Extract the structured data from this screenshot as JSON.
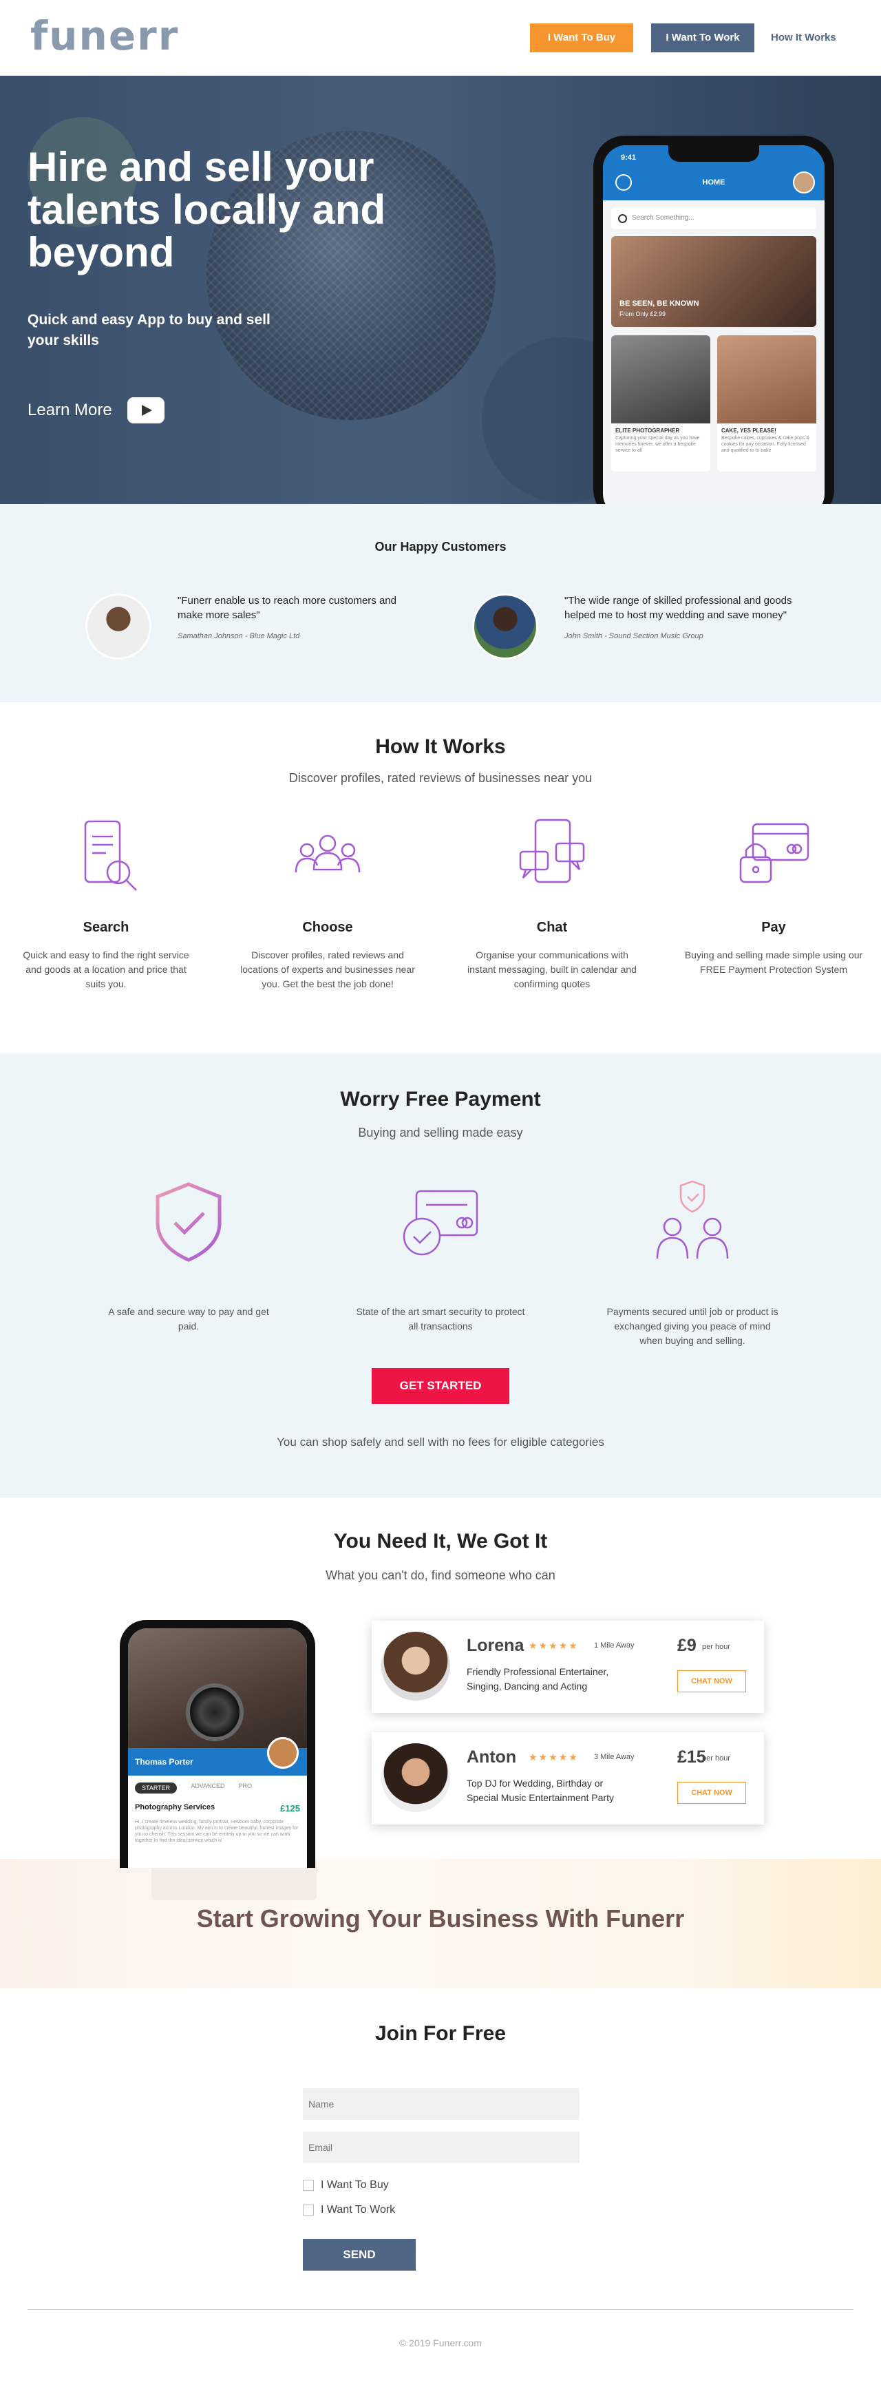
{
  "header": {
    "logo": "funerr",
    "buy_label": "I Want To Buy",
    "work_label": "I Want To Work",
    "how_label": "How It Works"
  },
  "hero": {
    "title": "Hire and sell your talents locally and beyond",
    "subtitle": "Quick and easy App to buy and sell your skills",
    "learn_more": "Learn More"
  },
  "phone": {
    "time": "9:41",
    "screen_title": "HOME",
    "search_placeholder": "Search Something...",
    "featured_title": "BE SEEN, BE KNOWN",
    "featured_sub": "From Only £2.99",
    "card1_title": "ELITE PHOTOGRAPHER",
    "card1_desc": "Capturing your special day as you have memories forever, we offer a bespoke service to all",
    "card2_title": "CAKE, YES PLEASE!",
    "card2_desc": "Bespoke cakes, cupcakes & cake pops & cookies for any occasion. Fully licensed and qualified to to bake"
  },
  "customers": {
    "heading": "Our Happy Customers",
    "items": [
      {
        "quote": "\"Funerr enable us to reach more customers and make more sales\"",
        "who": "Samathan Johnson - Blue Magic Ltd"
      },
      {
        "quote": "\"The wide range of skilled professional and goods helped me to host my wedding and save money\"",
        "who": "John Smith - Sound Section Music Group"
      }
    ]
  },
  "how": {
    "title": "How It Works",
    "subtitle": "Discover profiles, rated reviews of businesses near you",
    "items": [
      {
        "title": "Search",
        "text": "Quick and easy to find the right service and goods at a location and price that suits you.",
        "icon": "search-phone-icon"
      },
      {
        "title": "Choose",
        "text": "Discover profiles, rated reviews and locations of experts and businesses near you. Get the best the job done!",
        "icon": "people-group-icon"
      },
      {
        "title": "Chat",
        "text": "Organise your communications with instant messaging, built in calendar and confirming quotes",
        "icon": "chat-phone-icon"
      },
      {
        "title": "Pay",
        "text": "Buying and selling made simple using our FREE Payment Protection System",
        "icon": "card-lock-icon"
      }
    ]
  },
  "payment": {
    "title": "Worry Free Payment",
    "subtitle": "Buying and selling made easy",
    "items": [
      {
        "text": "A safe and secure way to pay and get paid.",
        "icon": "shield-check-icon"
      },
      {
        "text": "State of the art smart security to protect all transactions",
        "icon": "card-check-icon"
      },
      {
        "text": "Payments secured until job or product is exchanged giving you peace of mind when buying and selling.",
        "icon": "people-shield-icon"
      }
    ],
    "cta": "GET STARTED",
    "note": "You can shop safely and sell with no fees for eligible categories"
  },
  "need": {
    "title": "You Need It, We Got It",
    "subtitle": "What you can't do, find someone who can",
    "phone": {
      "name": "Thomas Porter",
      "tabs": [
        "STARTER",
        "ADVANCED",
        "PRO"
      ],
      "service": "Photography Services",
      "price": "£125",
      "desc": "Hi, I create timeless wedding, family portrait, newborn baby, corporate photography across London. My aim is to create beautiful, honest images for you to cherish. This session we can be entirely up to you so we can work together to find the ideal service which is"
    },
    "profiles": [
      {
        "name": "Lorena",
        "stars": "★★★★★",
        "distance": "1 Mile Away",
        "desc": "Friendly Professional Entertainer, Singing, Dancing and Acting",
        "price": "£9",
        "per": "per hour",
        "chat": "CHAT NOW"
      },
      {
        "name": "Anton",
        "stars": "★★★★★",
        "distance": "3 Mile Away",
        "desc": "Top DJ for Wedding, Birthday or Special Music Entertainment Party",
        "price": "£15",
        "per": "per hour",
        "chat": "CHAT NOW"
      }
    ]
  },
  "grow": {
    "title": "Start Growing Your Business With Funerr"
  },
  "join": {
    "title": "Join For Free",
    "name_placeholder": "Name",
    "email_placeholder": "Email",
    "buy_option": "I Want To Buy",
    "work_option": "I Want To Work",
    "send": "SEND"
  },
  "footer": {
    "copyright": "© 2019 Funerr.com"
  },
  "colors": {
    "accent_orange": "#f7962e",
    "navy": "#4f6584",
    "cta_red": "#ee1444",
    "icon_purple": "#a35ad6",
    "light_bg": "#eef5f8"
  }
}
